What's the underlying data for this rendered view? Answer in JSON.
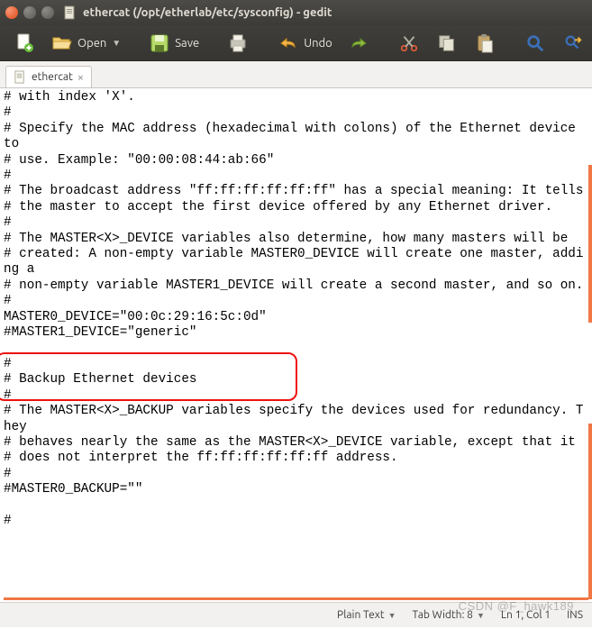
{
  "window": {
    "title": "ethercat (/opt/etherlab/etc/sysconfig) - gedit"
  },
  "toolbar": {
    "open_label": "Open",
    "save_label": "Save",
    "undo_label": "Undo"
  },
  "tab": {
    "filename": "ethercat"
  },
  "editor_text": "# with index 'X'.\n#\n# Specify the MAC address (hexadecimal with colons) of the Ethernet device to\n# use. Example: \"00:00:08:44:ab:66\"\n#\n# The broadcast address \"ff:ff:ff:ff:ff:ff\" has a special meaning: It tells\n# the master to accept the first device offered by any Ethernet driver.\n#\n# The MASTER<X>_DEVICE variables also determine, how many masters will be\n# created: A non-empty variable MASTER0_DEVICE will create one master, adding a\n# non-empty variable MASTER1_DEVICE will create a second master, and so on.\n#\nMASTER0_DEVICE=\"00:0c:29:16:5c:0d\"\n#MASTER1_DEVICE=\"generic\"\n\n#\n# Backup Ethernet devices\n#\n# The MASTER<X>_BACKUP variables specify the devices used for redundancy. They\n# behaves nearly the same as the MASTER<X>_DEVICE variable, except that it\n# does not interpret the ff:ff:ff:ff:ff:ff address.\n#\n#MASTER0_BACKUP=\"\"\n\n#\n",
  "statusbar": {
    "syntax": "Plain Text",
    "tab_width": "Tab Width: 8",
    "position": "Ln 1, Col 1",
    "insert_mode": "INS"
  },
  "watermark": "CSDN @F_hawk189"
}
